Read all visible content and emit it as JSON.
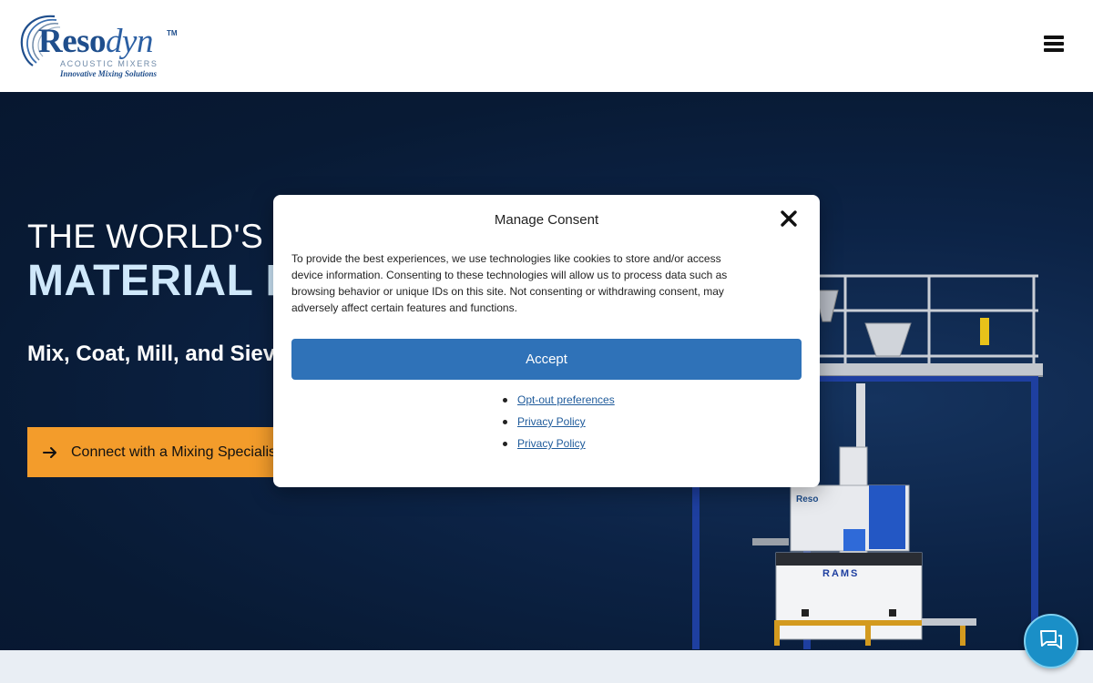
{
  "header": {
    "logo": {
      "brand_main": "Reso",
      "brand_italic": "dyn",
      "trademark": "TM",
      "subtitle": "ACOUSTIC MIXERS",
      "tagline": "Innovative Mixing Solutions"
    },
    "menu_icon": "hamburger-menu-icon"
  },
  "hero": {
    "line1": "THE WORLD'S M",
    "line2": "MATERIAL P",
    "subheading": "Mix, Coat, Mill, and Siev Ever Before",
    "cta_label": "Connect with a Mixing Specialis",
    "cta_icon": "arrow-right-icon",
    "machine_labels": {
      "unit_brand": "Reso",
      "base_label": "RAMS"
    }
  },
  "consent": {
    "title": "Manage Consent",
    "body": "To provide the best experiences, we use technologies like cookies to store and/or access device information. Consenting to these technologies will allow us to process data such as browsing behavior or unique IDs on this site. Not consenting or withdrawing consent, may adversely affect certain features and functions.",
    "accept_label": "Accept",
    "links": [
      "Opt-out preferences",
      "Privacy Policy",
      "Privacy Policy"
    ],
    "close_icon": "close-icon"
  },
  "chat": {
    "icon": "chat-icon"
  },
  "colors": {
    "brand_blue": "#1f4e8c",
    "hero_bg": "#0c2346",
    "hero_accent_text": "#cfe8fb",
    "cta_orange": "#f39c2b",
    "accept_blue": "#2f72b8",
    "chat_blue": "#1a8fc7"
  }
}
